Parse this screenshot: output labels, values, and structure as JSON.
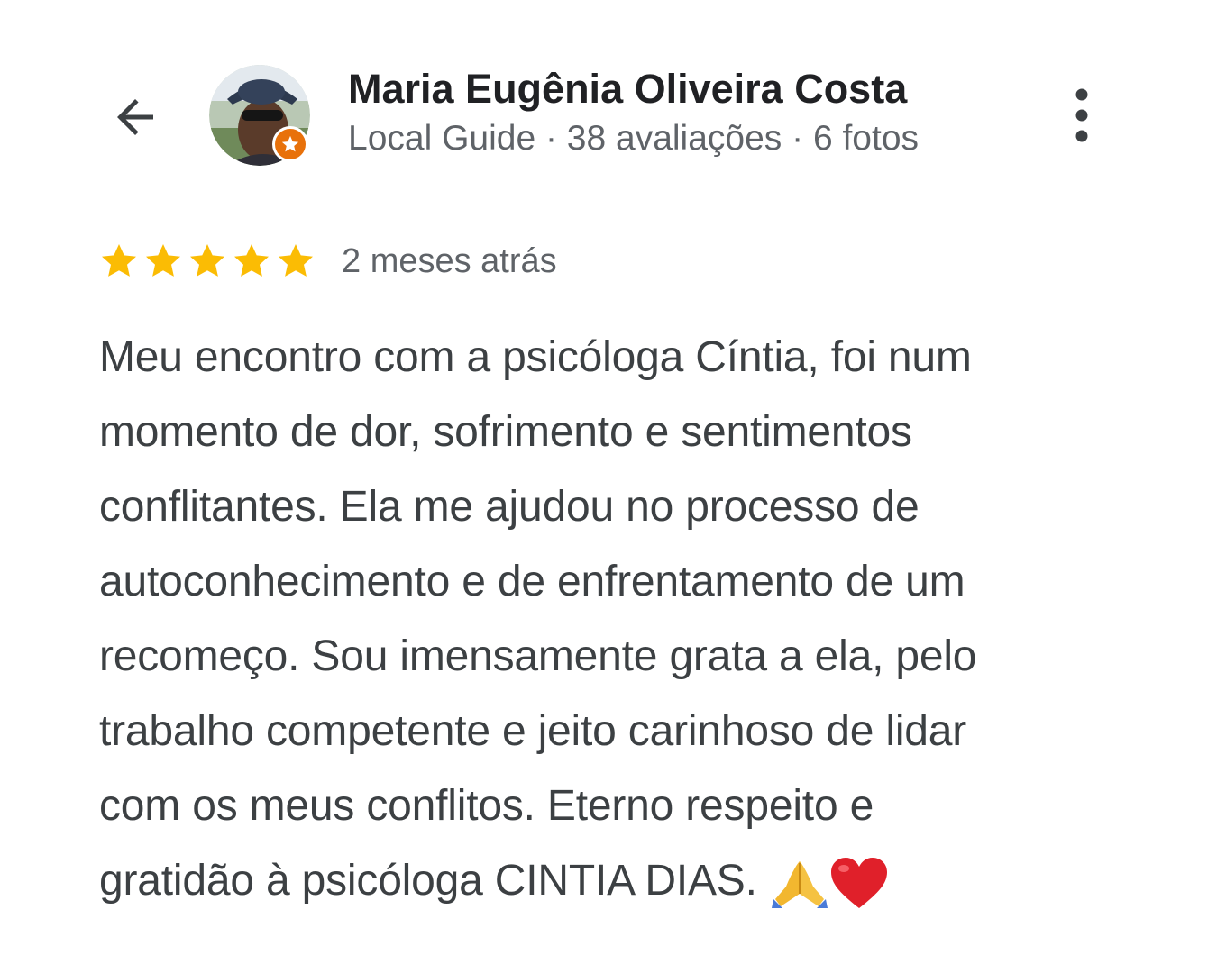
{
  "header": {
    "back_icon": "arrow-left-icon",
    "user_name": "Maria Eugênia Oliveira Costa",
    "user_meta": "Local Guide · 38 avaliações · 6 fotos",
    "avatar_badge_icon": "star-badge-icon",
    "more_icon": "more-vert-icon"
  },
  "review": {
    "rating": 5,
    "rating_max": 5,
    "star_color": "#fbbc04",
    "date": "2 meses atrás",
    "text_lines": [
      "Meu encontro com a psicóloga Cíntia, foi num",
      "momento de dor, sofrimento e sentimentos",
      "conflitantes. Ela me ajudou no processo de",
      "autoconhecimento e de enfrentamento de um",
      "recomeço. Sou imensamente grata a ela, pelo",
      "trabalho competente e jeito carinhoso de lidar",
      "com os meus conflitos. Eterno respeito e",
      "gratidão à psicóloga CINTIA DIAS."
    ],
    "emojis": [
      "folded-hands-icon",
      "red-heart-icon"
    ]
  },
  "colors": {
    "name": "#202124",
    "meta": "#5f6368",
    "body": "#3c4043",
    "badge": "#e8710a"
  }
}
